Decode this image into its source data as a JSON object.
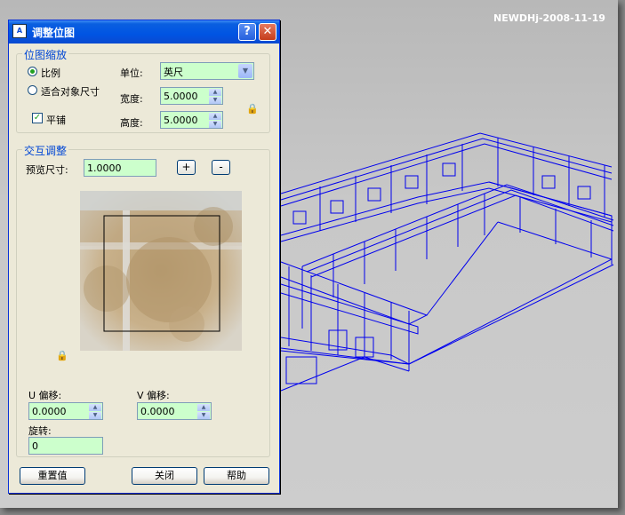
{
  "watermark": "NEWDHj-2008-11-19",
  "dialog": {
    "title": "调整位图",
    "help_icon": "?",
    "close_icon": "✕",
    "scaling_group": {
      "label": "位图缩放",
      "radio_scale": "比例",
      "radio_fit": "适合对象尺寸",
      "selected": "比例",
      "tile_label": "平铺",
      "tile_checked": true,
      "unit_label": "单位:",
      "unit_value": "英尺",
      "width_label": "宽度:",
      "width_value": "5.0000",
      "height_label": "高度:",
      "height_value": "5.0000"
    },
    "interactive_group": {
      "label": "交互调整",
      "preview_size_label": "预览尺寸:",
      "preview_size_value": "1.0000",
      "plus_label": "+",
      "minus_label": "-",
      "u_offset_label": "U 偏移:",
      "u_offset_value": "0.0000",
      "v_offset_label": "V 偏移:",
      "v_offset_value": "0.0000",
      "rotate_label": "旋转:",
      "rotate_value": "0"
    },
    "buttons": {
      "reset": "重置值",
      "close": "关闭",
      "help": "帮助"
    }
  },
  "colors": {
    "model_wire": "#0000ee",
    "field_bg": "#ccffcc",
    "title_blue": "#0054e3"
  }
}
